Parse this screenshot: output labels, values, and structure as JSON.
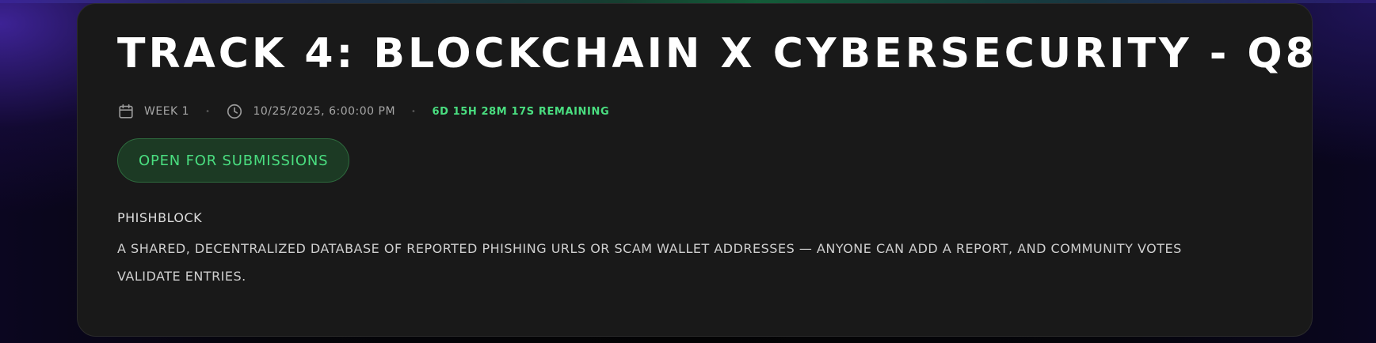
{
  "track": {
    "title": "TRACK 4: BLOCKCHAIN X CYBERSECURITY - Q8"
  },
  "meta": {
    "calendar_icon": "calendar-icon",
    "week": "WEEK 1",
    "clock_icon": "clock-icon",
    "datetime": "10/25/2025, 6:00:00 PM",
    "remaining": "6D 15H 28M 17S REMAINING",
    "separator": "•"
  },
  "status": {
    "label": "OPEN FOR SUBMISSIONS"
  },
  "project": {
    "name": "PHISHBLOCK",
    "description": "A SHARED, DECENTRALIZED DATABASE OF REPORTED PHISHING URLS OR SCAM WALLET ADDRESSES — ANYONE CAN ADD A REPORT, AND COMMUNITY VOTES VALIDATE ENTRIES."
  },
  "colors": {
    "accent_green": "#4ade80",
    "card_bg": "#191919",
    "badge_bg": "#1c3a24"
  }
}
